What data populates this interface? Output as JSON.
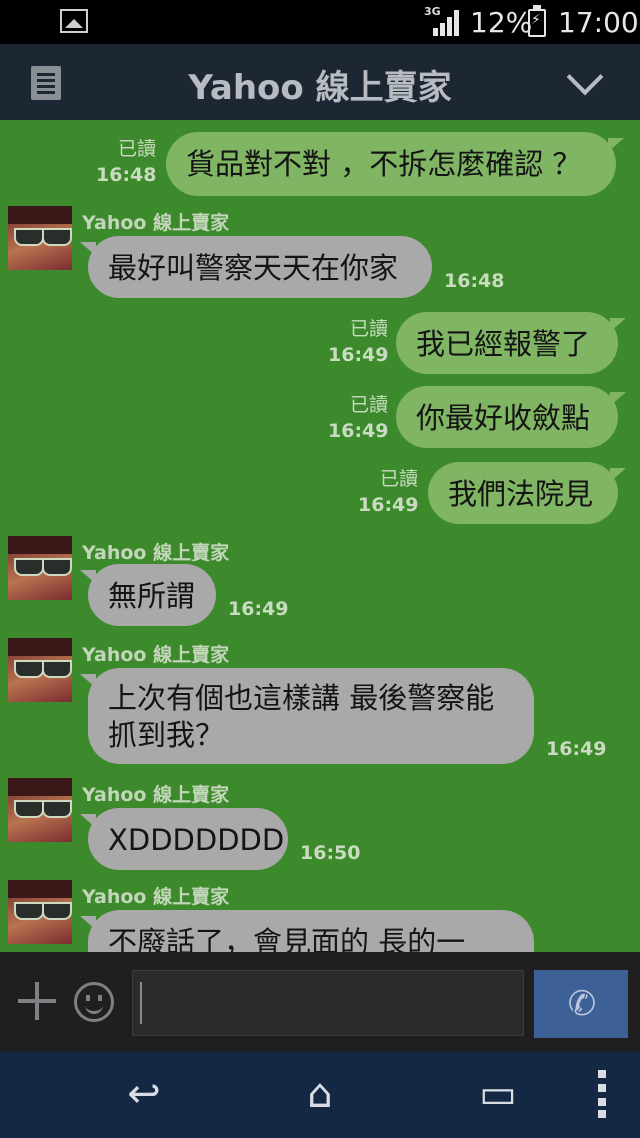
{
  "status_bar": {
    "network": "3G",
    "battery_percent": "12%",
    "time": "17:00",
    "icons": [
      "image-icon",
      "signal-icon",
      "battery-charging-icon"
    ]
  },
  "header": {
    "title": "Yahoo 線上賣家",
    "menu_icon": "menu-icon",
    "dropdown_icon": "chevron-down-icon"
  },
  "chat": {
    "background_color": "#3d8a2c",
    "messages": [
      {
        "from": "me",
        "text": "貨品對不對 ，不拆怎麼確認 ？",
        "read": "已讀",
        "time": "16:48"
      },
      {
        "from": "them",
        "sender": "Yahoo 線上賣家",
        "text": "最好叫警察天天在你家",
        "time": "16:48"
      },
      {
        "from": "me",
        "text": "我已經報警了",
        "read": "已讀",
        "time": "16:49"
      },
      {
        "from": "me",
        "text": "你最好收斂點",
        "read": "已讀",
        "time": "16:49"
      },
      {
        "from": "me",
        "text": "我們法院見",
        "read": "已讀",
        "time": "16:49"
      },
      {
        "from": "them",
        "sender": "Yahoo 線上賣家",
        "text": "無所謂",
        "time": "16:49"
      },
      {
        "from": "them",
        "sender": "Yahoo 線上賣家",
        "text_line1": "上次有個也這樣講 最後警察能",
        "text_line2": "抓到我？",
        "time": "16:49"
      },
      {
        "from": "them",
        "sender": "Yahoo 線上賣家",
        "text": "XDDDDDDD",
        "time": "16:50"
      },
      {
        "from": "them",
        "sender": "Yahoo 線上賣家",
        "text": "不廢話了，會見面的  長的一"
      }
    ]
  },
  "input_bar": {
    "value": "",
    "placeholder": ""
  },
  "nav_bar": {
    "icons": [
      "back-icon",
      "home-icon",
      "recent-apps-icon",
      "more-icon"
    ]
  }
}
